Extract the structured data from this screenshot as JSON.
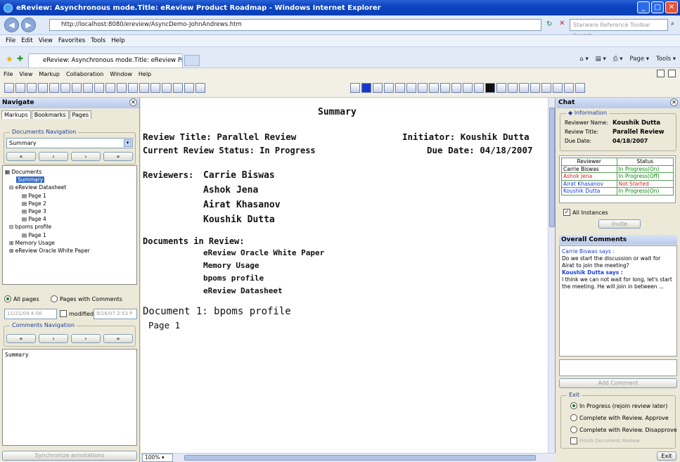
{
  "window": {
    "title": "eReview: Asynchronous mode.Title: eReview Product Roadmap - Windows Internet Explorer"
  },
  "browser": {
    "address": "http://localhost:8080/ereview/AsyncDemo-JohnAndrews.htm",
    "search_placeholder": "Starware Reference Toolbar Search",
    "menu": [
      "File",
      "Edit",
      "View",
      "Favorites",
      "Tools",
      "Help"
    ],
    "tab_label": "eReview: Asynchronous mode.Title: eReview Product...",
    "commands": [
      "Page",
      "Tools"
    ]
  },
  "app": {
    "menu": [
      "File",
      "View",
      "Markup",
      "Collaboration",
      "Window",
      "Help"
    ]
  },
  "navigate": {
    "title": "Navigate",
    "tabs": [
      "Markups",
      "Bookmarks",
      "Pages"
    ],
    "doc_nav_legend": "Documents Navigation",
    "doc_select": "Summary",
    "tree": [
      {
        "label": "Documents",
        "level": 0
      },
      {
        "label": "Summary",
        "level": 2,
        "selected": true
      },
      {
        "label": "eReview Datasheet",
        "level": 1
      },
      {
        "label": "Page 1",
        "level": 2
      },
      {
        "label": "Page 2",
        "level": 2
      },
      {
        "label": "Page 3",
        "level": 2
      },
      {
        "label": "Page 4",
        "level": 2
      },
      {
        "label": "bpoms profile",
        "level": 1
      },
      {
        "label": "Page 1",
        "level": 2
      },
      {
        "label": "Memory Usage",
        "level": 1
      },
      {
        "label": "eReview Oracle White Paper",
        "level": 1
      }
    ],
    "radio_all": "All pages",
    "radio_comments": "Pages with Comments",
    "date_from": "11/21/09 4:08",
    "modified_label": "modified",
    "date_to": "9/26/07 2:53 P",
    "comments_nav_legend": "Comments Navigation",
    "notes_text": "Summary",
    "sync_button": "Synchronize annotations"
  },
  "document": {
    "heading": "Summary",
    "review_title": "Review Title: Parallel Review",
    "initiator": "Initiator: Koushik Dutta",
    "status": "Current Review Status: In Progress",
    "due_date": "Due Date: 04/18/2007",
    "reviewers_label": "Reviewers:",
    "reviewers": [
      "Carrie Biswas",
      "Ashok Jena",
      "Airat Khasanov",
      "Koushik Dutta"
    ],
    "docs_label": "Documents in Review:",
    "docs": [
      "eReview Oracle White Paper",
      "Memory Usage",
      "bpoms profile",
      "eReview Datasheet"
    ],
    "doc1_heading": "Document 1: bpoms profile",
    "page_label": "Page 1",
    "zoom": "100%"
  },
  "chat": {
    "title": "Chat",
    "info_legend": "Information",
    "reviewer_name_label": "Reviewer Name:",
    "reviewer_name": "Koushik Dutta",
    "review_title_label": "Review Title:",
    "review_title": "Parallel Review",
    "due_date_label": "Due Date:",
    "due_date": "04/18/2007",
    "col_reviewer": "Reviewer",
    "col_status": "Status",
    "reviewers": [
      {
        "name": "Carrie Biswas",
        "status": "In Progress(On)",
        "name_color": "#000000",
        "status_color": "#0a8a0a"
      },
      {
        "name": "Ashok Jena",
        "status": "In Progress(Off)",
        "name_color": "#e02020",
        "status_color": "#0a8a0a"
      },
      {
        "name": "Airat Khasanov",
        "status": "Not Started",
        "name_color": "#1a3fd8",
        "status_color": "#e02020"
      },
      {
        "name": "Koushik Dutta",
        "status": "In Progress(On)",
        "name_color": "#1a3fd8",
        "status_color": "#0a8a0a"
      }
    ],
    "all_instances": "All Instances",
    "invite": "Invite",
    "overall_title": "Overall Comments",
    "comment1_author": "Carrie Biswas says :",
    "comment1_text": "Do we start the discussion or wait for Airat to join the meeting?",
    "comment2_author": "Koushik Dutta says :",
    "comment2_text": "I think we can not wait for long, let's start the meeting. He will join in between ...",
    "add_comment": "Add Comment",
    "exit_legend": "Exit",
    "exit_options": [
      "In Progress (rejoin review later)",
      "Complete with Review.  Approve",
      "Complete with Review.  Disapprove"
    ],
    "finish_label": "Finish Document Review",
    "exit_button": "Exit"
  }
}
